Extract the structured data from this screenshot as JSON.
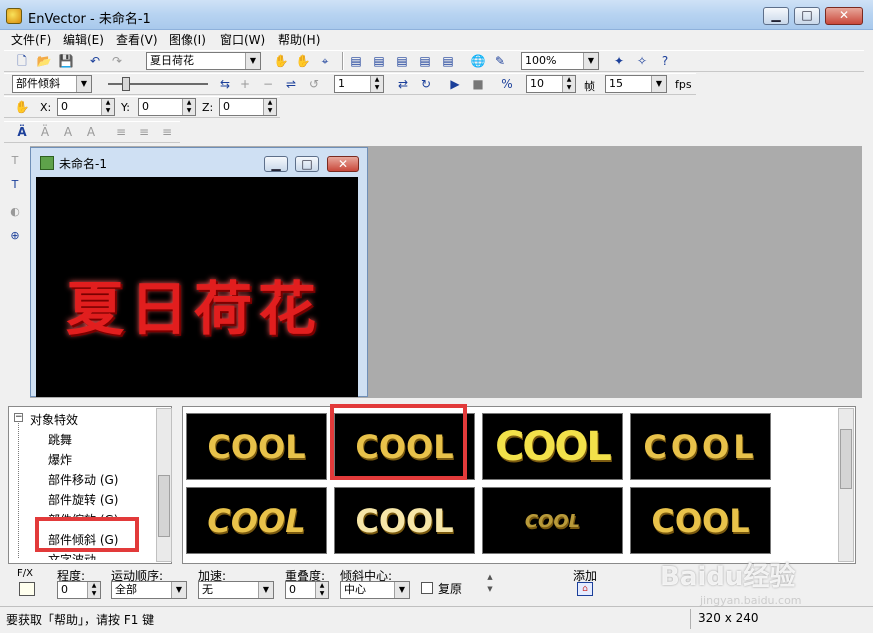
{
  "window": {
    "title": "EnVector - 未命名-1",
    "min_glyph": "▁",
    "max_glyph": "□",
    "close_glyph": "✕"
  },
  "menu": [
    {
      "label": "文件(F)"
    },
    {
      "label": "编辑(E)"
    },
    {
      "label": "查看(V)"
    },
    {
      "label": "图像(I)"
    },
    {
      "label": "窗口(W)"
    },
    {
      "label": "帮助(H)"
    }
  ],
  "toolbar1": {
    "text_combo": "夏日荷花",
    "zoom_combo": "100%"
  },
  "toolbar2": {
    "effect_combo": "部件倾斜",
    "frame_spin": "1",
    "step_spin": "10",
    "frame_label": "帧",
    "fps_combo": "15",
    "fps_label": "fps"
  },
  "toolbar3": {
    "x_label": "X:",
    "x_value": "0",
    "y_label": "Y:",
    "y_value": "0",
    "z_label": "Z:",
    "z_value": "0"
  },
  "child_window": {
    "title": "未命名-1",
    "canvas_text": "夏日荷花",
    "text_color": "#e11e1e"
  },
  "tree": {
    "root": "对象特效",
    "items": [
      "跳舞",
      "爆炸",
      "部件移动 (G)",
      "部件旋转 (G)",
      "部件缩放 (G)",
      "部件倾斜 (G)",
      "文字波动"
    ],
    "highlighted": "部件倾斜 (G)"
  },
  "gallery": {
    "thumb_text": "COOL",
    "thumb_color": "#e8c24a",
    "highlight_color": "#e23a3a"
  },
  "props": {
    "fx_label": "F/X",
    "degree_label": "程度:",
    "degree_value": "0",
    "order_label": "运动顺序:",
    "order_value": "全部",
    "accel_label": "加速:",
    "accel_value": "无",
    "overlap_label": "重叠度:",
    "overlap_value": "0",
    "center_label": "倾斜中心:",
    "center_value": "中心",
    "restore_label": "复原",
    "add_label": "添加"
  },
  "status": {
    "text": "要获取「帮助」，请按 F1 键",
    "size": "320 x 240"
  },
  "watermark": {
    "text": "Baidu经验",
    "sub": "jingyan.baidu.com"
  }
}
